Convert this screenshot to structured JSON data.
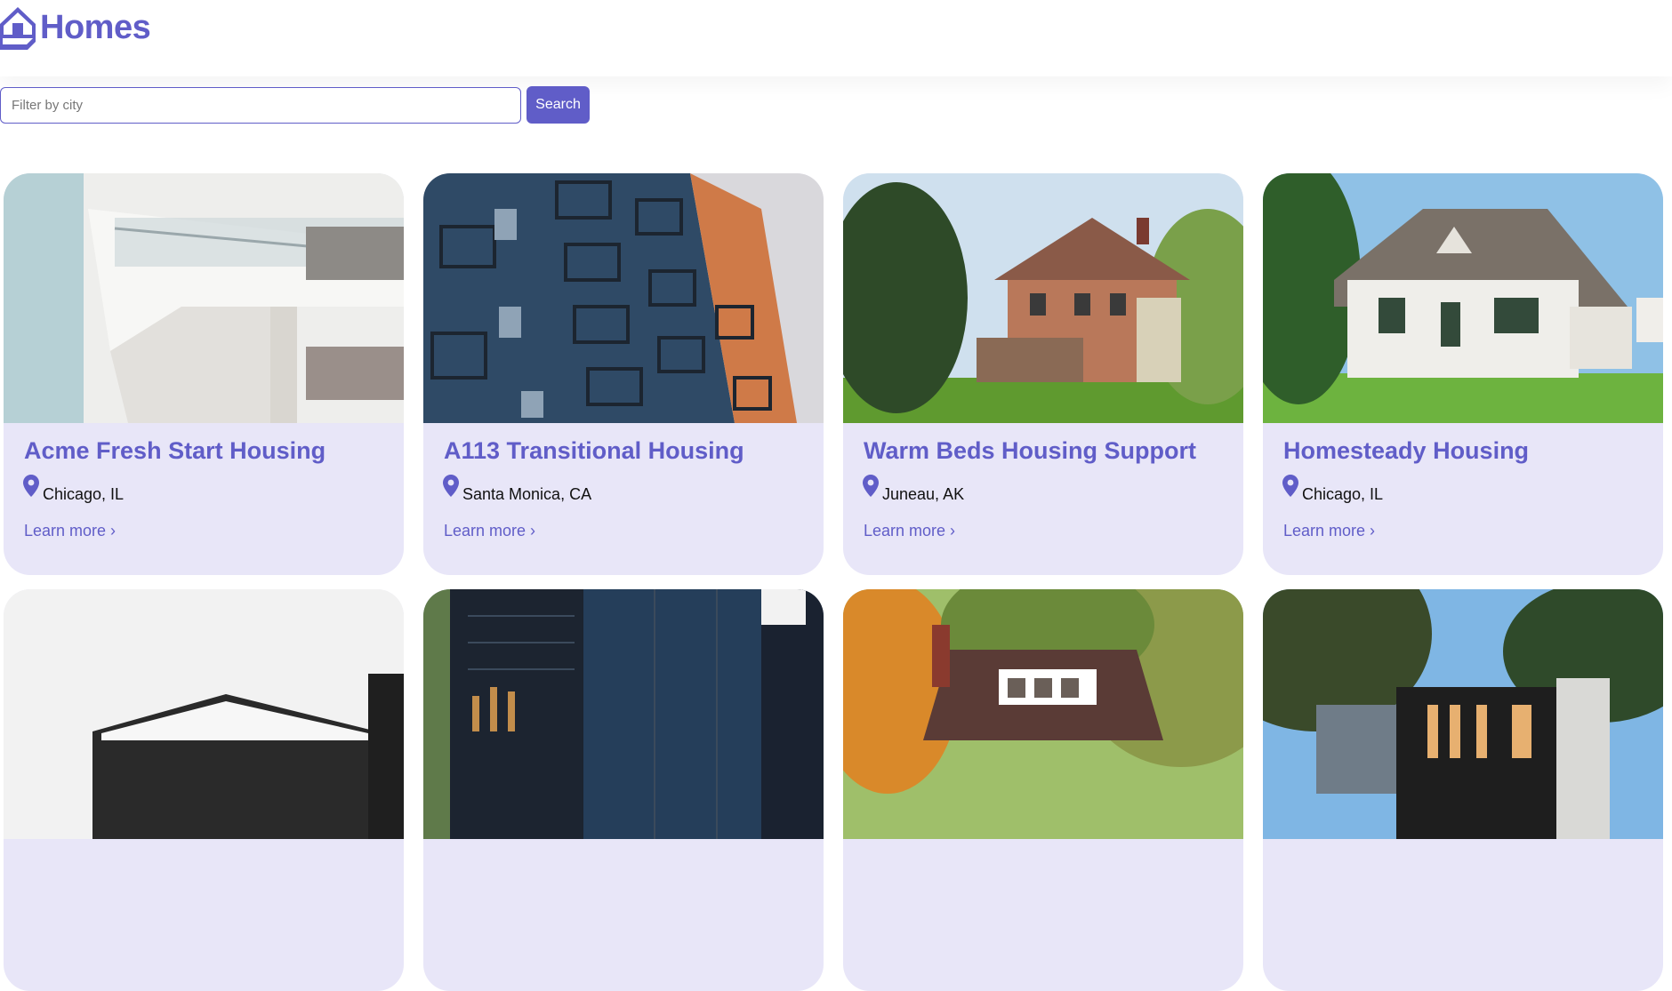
{
  "app": {
    "brand_name": "Homes"
  },
  "search": {
    "placeholder": "Filter by city",
    "value": "",
    "button_label": "Search"
  },
  "brand_color": "#605dc8",
  "card_background": "#e8e6f8",
  "listings": [
    {
      "title": "Acme Fresh Start Housing",
      "location": "Chicago, IL",
      "link": "Learn more ›",
      "photo": "modern-white-apartment-building"
    },
    {
      "title": "A113 Transitional Housing",
      "location": "Santa Monica, CA",
      "link": "Learn more ›",
      "photo": "blue-apartment-balconies"
    },
    {
      "title": "Warm Beds Housing Support",
      "location": "Juneau, AK",
      "link": "Learn more ›",
      "photo": "victorian-house-with-porch"
    },
    {
      "title": "Homesteady Housing",
      "location": "Chicago, IL",
      "link": "Learn more ›",
      "photo": "white-cape-cod-house"
    },
    {
      "photo": "modern-house-white-sky"
    },
    {
      "photo": "dark-modern-building"
    },
    {
      "photo": "house-in-autumn-trees"
    },
    {
      "photo": "modern-dark-house-in-trees"
    }
  ]
}
